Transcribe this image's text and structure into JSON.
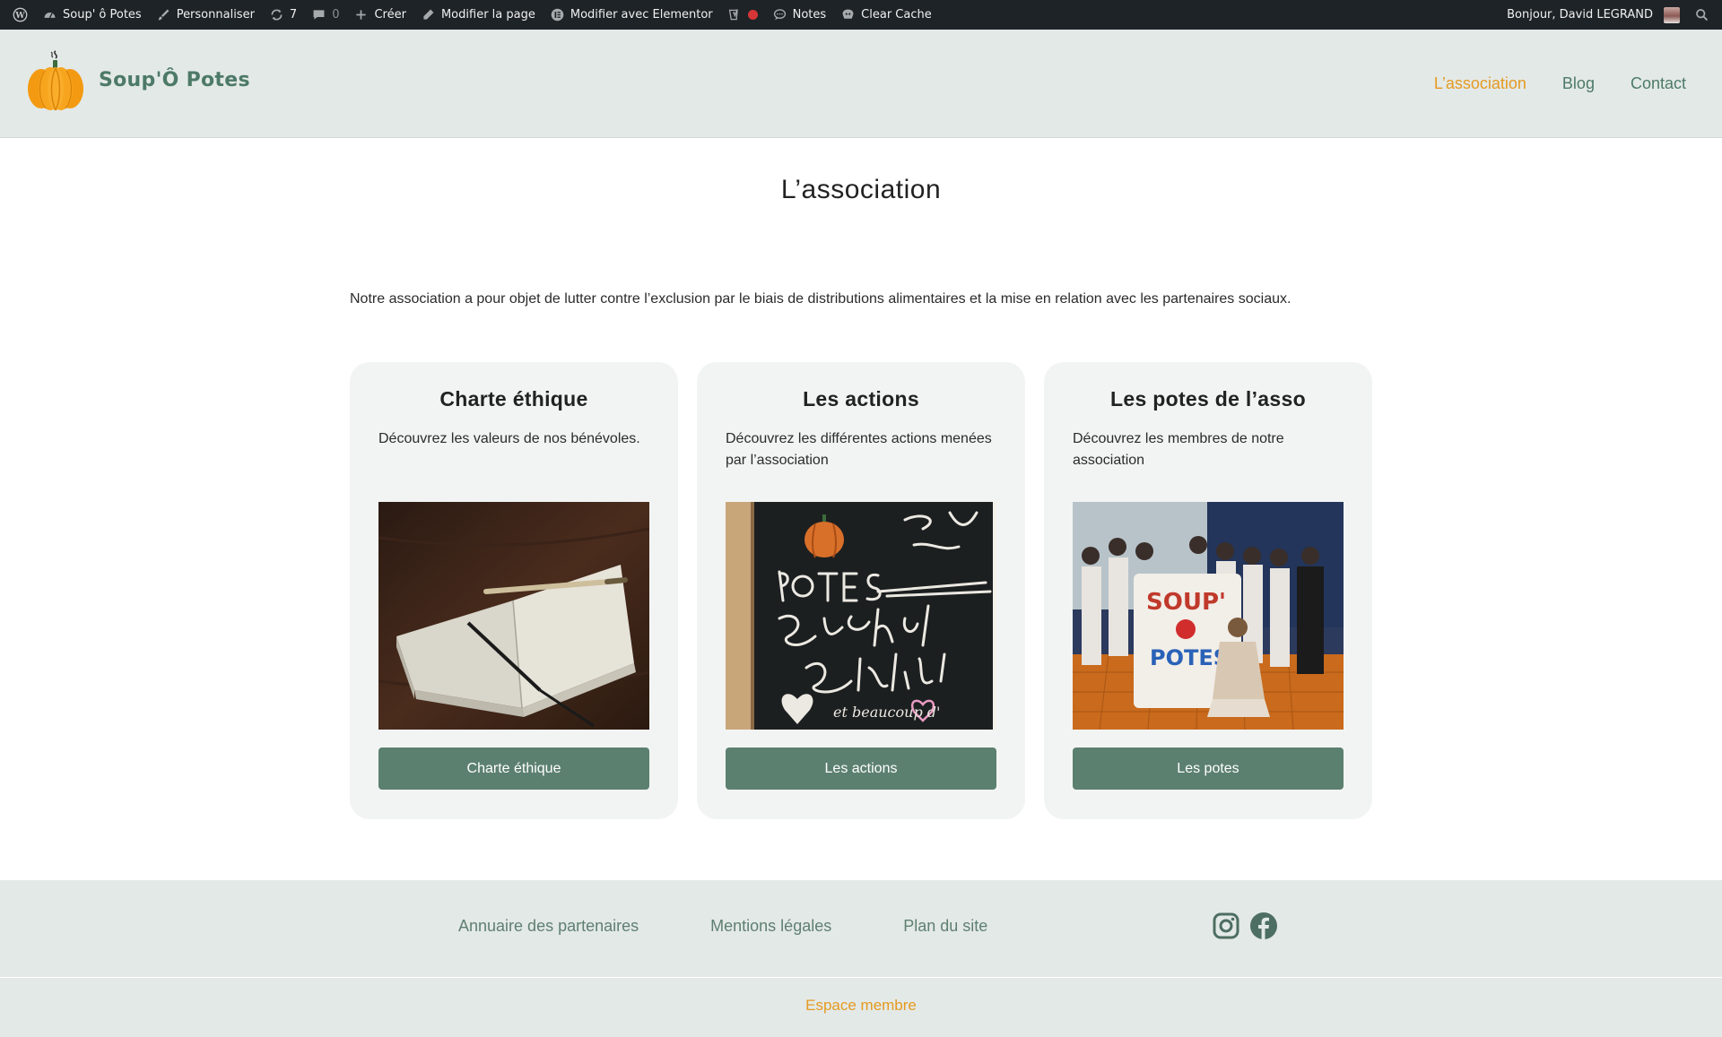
{
  "admin_bar": {
    "site_name": "Soup' ô Potes",
    "customize": "Personnaliser",
    "updates_count": "7",
    "comments_count": "0",
    "create": "Créer",
    "edit_page": "Modifier la page",
    "edit_elementor": "Modifier avec Elementor",
    "notes": "Notes",
    "clear_cache": "Clear Cache",
    "greeting": "Bonjour, David LEGRAND"
  },
  "header": {
    "logo_text": "Soup'Ô Potes",
    "nav": [
      {
        "label": "L’association",
        "active": true
      },
      {
        "label": "Blog",
        "active": false
      },
      {
        "label": "Contact",
        "active": false
      }
    ]
  },
  "main": {
    "title": "L’association",
    "intro": "Notre association a pour objet de lutter contre l’exclusion par le biais de distributions alimentaires et la mise en relation avec les partenaires sociaux.",
    "cards": [
      {
        "title": "Charte éthique",
        "description": "Découvrez les valeurs de nos bénévoles.",
        "button": "Charte éthique"
      },
      {
        "title": "Les actions",
        "description": "Découvrez les différentes actions menées par l’association",
        "button": "Les actions"
      },
      {
        "title": "Les potes de l’asso",
        "description": "Découvrez les membres de notre association",
        "button": "Les potes"
      }
    ]
  },
  "footer": {
    "links": [
      "Annuaire des partenaires",
      "Mentions légales",
      "Plan du site"
    ],
    "social": [
      "instagram-icon",
      "facebook-icon"
    ],
    "member_link": "Espace membre"
  },
  "colors": {
    "brand_green": "#5c8070",
    "accent_orange": "#e59a21",
    "header_bg": "#e3e9e7",
    "admin_bar_bg": "#1d2327"
  }
}
